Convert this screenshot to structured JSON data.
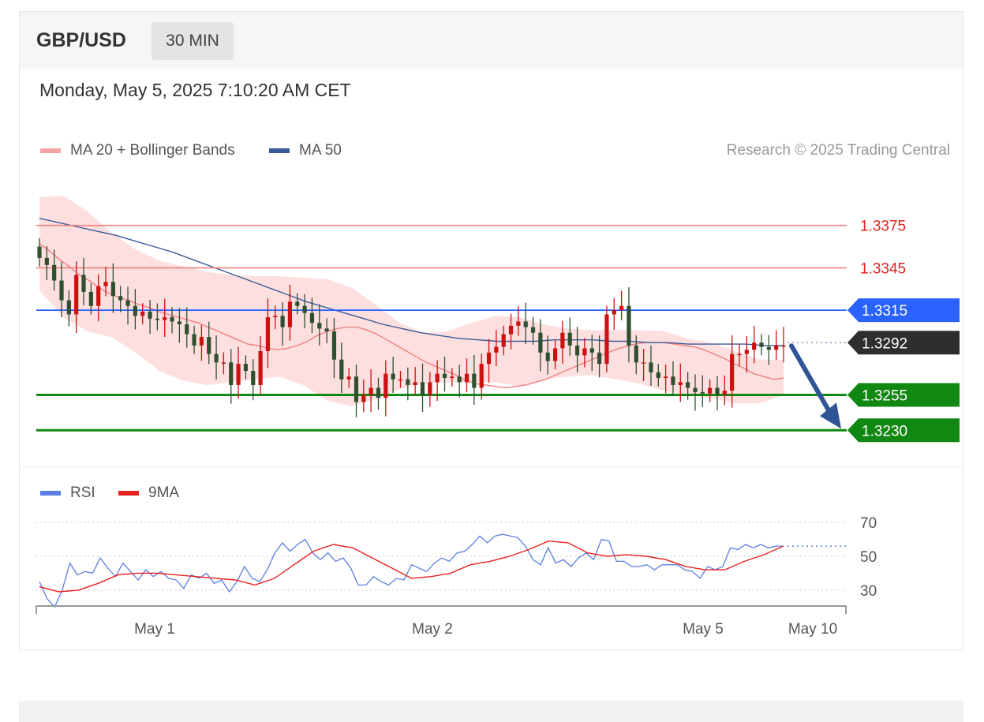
{
  "header": {
    "symbol": "GBP/USD",
    "timeframe": "30 MIN"
  },
  "datetime": "Monday, May 5, 2025 7:10:20 AM CET",
  "legend": {
    "ma20": "MA 20 + Bollinger Bands",
    "ma50": "MA 50",
    "rsi": "RSI",
    "rsi_ma": "9MA"
  },
  "copyright": "Research © 2025 Trading Central",
  "colors": {
    "ma20": "#f08080",
    "ma50": "#3a5b9a",
    "band": "#fdd9d9",
    "bull": "#cc1111",
    "bear": "#2f4f2f",
    "resistance": "#f08080",
    "pivot": "#2962ff",
    "support": "#118811",
    "current": "#2e2e2e",
    "arrow": "#2f5597",
    "rsi": "#5b7fe0",
    "rsi_ma": "#e82020"
  },
  "chart_data": [
    {
      "type": "candlestick",
      "title": "GBP/USD 30 MIN",
      "x_ticks": [
        "May 1",
        "May 2",
        "May 5",
        "May 10"
      ],
      "ylim": [
        1.3205,
        1.3405
      ],
      "levels": [
        {
          "label": "1.3375",
          "value": 1.3375,
          "kind": "resistance"
        },
        {
          "label": "1.3345",
          "value": 1.3345,
          "kind": "resistance"
        },
        {
          "label": "1.3315",
          "value": 1.3315,
          "kind": "pivot"
        },
        {
          "label": "1.3292",
          "value": 1.3292,
          "kind": "current"
        },
        {
          "label": "1.3255",
          "value": 1.3255,
          "kind": "support"
        },
        {
          "label": "1.3230",
          "value": 1.323,
          "kind": "support"
        }
      ],
      "forecast": {
        "direction": "down",
        "from": 1.3292,
        "to": 1.323
      },
      "close": [
        1.3352,
        1.3347,
        1.3336,
        1.3322,
        1.3312,
        1.334,
        1.3328,
        1.3318,
        1.3332,
        1.3335,
        1.3325,
        1.3322,
        1.3318,
        1.3311,
        1.3314,
        1.3309,
        1.3308,
        1.331,
        1.3307,
        1.3305,
        1.3298,
        1.329,
        1.3296,
        1.3284,
        1.3278,
        1.3278,
        1.3262,
        1.3277,
        1.3272,
        1.3262,
        1.3286,
        1.331,
        1.3311,
        1.3303,
        1.3321,
        1.3318,
        1.3313,
        1.3306,
        1.3302,
        1.33,
        1.328,
        1.3266,
        1.3268,
        1.325,
        1.3255,
        1.326,
        1.3253,
        1.327,
        1.3266,
        1.3266,
        1.3262,
        1.3264,
        1.3255,
        1.3264,
        1.327,
        1.3267,
        1.3268,
        1.3264,
        1.327,
        1.326,
        1.3277,
        1.3285,
        1.3289,
        1.3298,
        1.3304,
        1.3307,
        1.3303,
        1.3299,
        1.3285,
        1.3279,
        1.3288,
        1.3299,
        1.329,
        1.3283,
        1.3288,
        1.3285,
        1.3277,
        1.3312,
        1.3315,
        1.3318,
        1.329,
        1.3278,
        1.3278,
        1.3271,
        1.3267,
        1.3268,
        1.3262,
        1.3264,
        1.326,
        1.3257,
        1.3256,
        1.326,
        1.3255,
        1.3258,
        1.3284,
        1.3284,
        1.3287,
        1.3292,
        1.3289,
        1.3287,
        1.329,
        1.329
      ],
      "ma20": [
        1.3362,
        1.3357,
        1.3351,
        1.3346,
        1.334,
        1.3336,
        1.3331,
        1.3327,
        1.3324,
        1.3322,
        1.3319,
        1.3317,
        1.3314,
        1.3312,
        1.331,
        1.3308,
        1.3306,
        1.3303,
        1.33,
        1.3297,
        1.3294,
        1.3291,
        1.329,
        1.3288,
        1.3287,
        1.3288,
        1.329,
        1.3293,
        1.3297,
        1.33,
        1.3302,
        1.3303,
        1.3303,
        1.3301,
        1.3298,
        1.3294,
        1.329,
        1.3286,
        1.3282,
        1.3278,
        1.3275,
        1.3272,
        1.3269,
        1.3265,
        1.3263,
        1.3262,
        1.3261,
        1.326,
        1.3261,
        1.3262,
        1.3264,
        1.3266,
        1.3269,
        1.3272,
        1.3275,
        1.3278,
        1.3281,
        1.3284,
        1.3287,
        1.3289,
        1.3291,
        1.3292,
        1.3292,
        1.3292,
        1.3291,
        1.329,
        1.3289,
        1.3287,
        1.3284,
        1.3281,
        1.3277,
        1.3274,
        1.327,
        1.3268,
        1.3266,
        1.3267
      ],
      "ma50": [
        1.338,
        1.3377,
        1.3374,
        1.3371,
        1.3368,
        1.3364,
        1.336,
        1.3356,
        1.3351,
        1.3346,
        1.3341,
        1.3336,
        1.3331,
        1.3326,
        1.3321,
        1.3317,
        1.3313,
        1.3309,
        1.3305,
        1.3302,
        1.3299,
        1.3297,
        1.3295,
        1.3294,
        1.3293,
        1.3293,
        1.3293,
        1.3294,
        1.3294,
        1.3294,
        1.3293,
        1.3293,
        1.3292,
        1.3292,
        1.3291,
        1.3291,
        1.3291,
        1.3291,
        1.329,
        1.329
      ],
      "bb_upper": [
        1.3395,
        1.3396,
        1.3385,
        1.337,
        1.3358,
        1.335,
        1.3346,
        1.3342,
        1.334,
        1.3339,
        1.3339,
        1.3338,
        1.3337,
        1.3331,
        1.3319,
        1.3306,
        1.3299,
        1.33,
        1.3306,
        1.3311,
        1.331,
        1.3305,
        1.3302,
        1.3301,
        1.3301,
        1.3301,
        1.33,
        1.3295,
        1.3292,
        1.3286,
        1.328,
        1.328
      ],
      "bb_lower": [
        1.3329,
        1.331,
        1.33,
        1.3296,
        1.3285,
        1.3272,
        1.3265,
        1.3262,
        1.3264,
        1.3266,
        1.3268,
        1.3262,
        1.3251,
        1.3247,
        1.3252,
        1.3259,
        1.3263,
        1.3264,
        1.3264,
        1.3264,
        1.3261,
        1.3266,
        1.3268,
        1.3269,
        1.3266,
        1.3263,
        1.3258,
        1.3255,
        1.3253,
        1.3249,
        1.3249,
        1.3255
      ]
    },
    {
      "type": "line",
      "title": "RSI",
      "yticks": [
        "70",
        "50",
        "30"
      ],
      "ylim": [
        15,
        85
      ],
      "series": [
        {
          "name": "RSI",
          "values": [
            35,
            25,
            20,
            30,
            46,
            39,
            41,
            40,
            49,
            43,
            38,
            46,
            41,
            36,
            42,
            38,
            41,
            37,
            36,
            31,
            39,
            37,
            40,
            34,
            36,
            29,
            35,
            44,
            37,
            35,
            42,
            52,
            58,
            53,
            57,
            60,
            52,
            48,
            52,
            47,
            49,
            43,
            33,
            33,
            38,
            35,
            33,
            37,
            36,
            45,
            43,
            41,
            46,
            49,
            47,
            52,
            53,
            57,
            62,
            58,
            62,
            63,
            62,
            61,
            56,
            48,
            45,
            55,
            46,
            48,
            44,
            49,
            52,
            48,
            60,
            59,
            47,
            47,
            44,
            44,
            45,
            42,
            45,
            45,
            45,
            42,
            41,
            37,
            44,
            42,
            44,
            55,
            54,
            57,
            55,
            57,
            55,
            56,
            56
          ]
        },
        {
          "name": "9MA",
          "values": [
            32,
            29,
            30,
            34,
            39,
            40,
            40,
            39,
            38,
            37,
            36,
            33,
            37,
            45,
            53,
            57,
            55,
            49,
            43,
            37,
            38,
            40,
            45,
            47,
            50,
            54,
            59,
            58,
            52,
            50,
            51,
            50,
            48,
            44,
            42,
            42,
            47,
            51,
            56
          ]
        }
      ]
    }
  ]
}
